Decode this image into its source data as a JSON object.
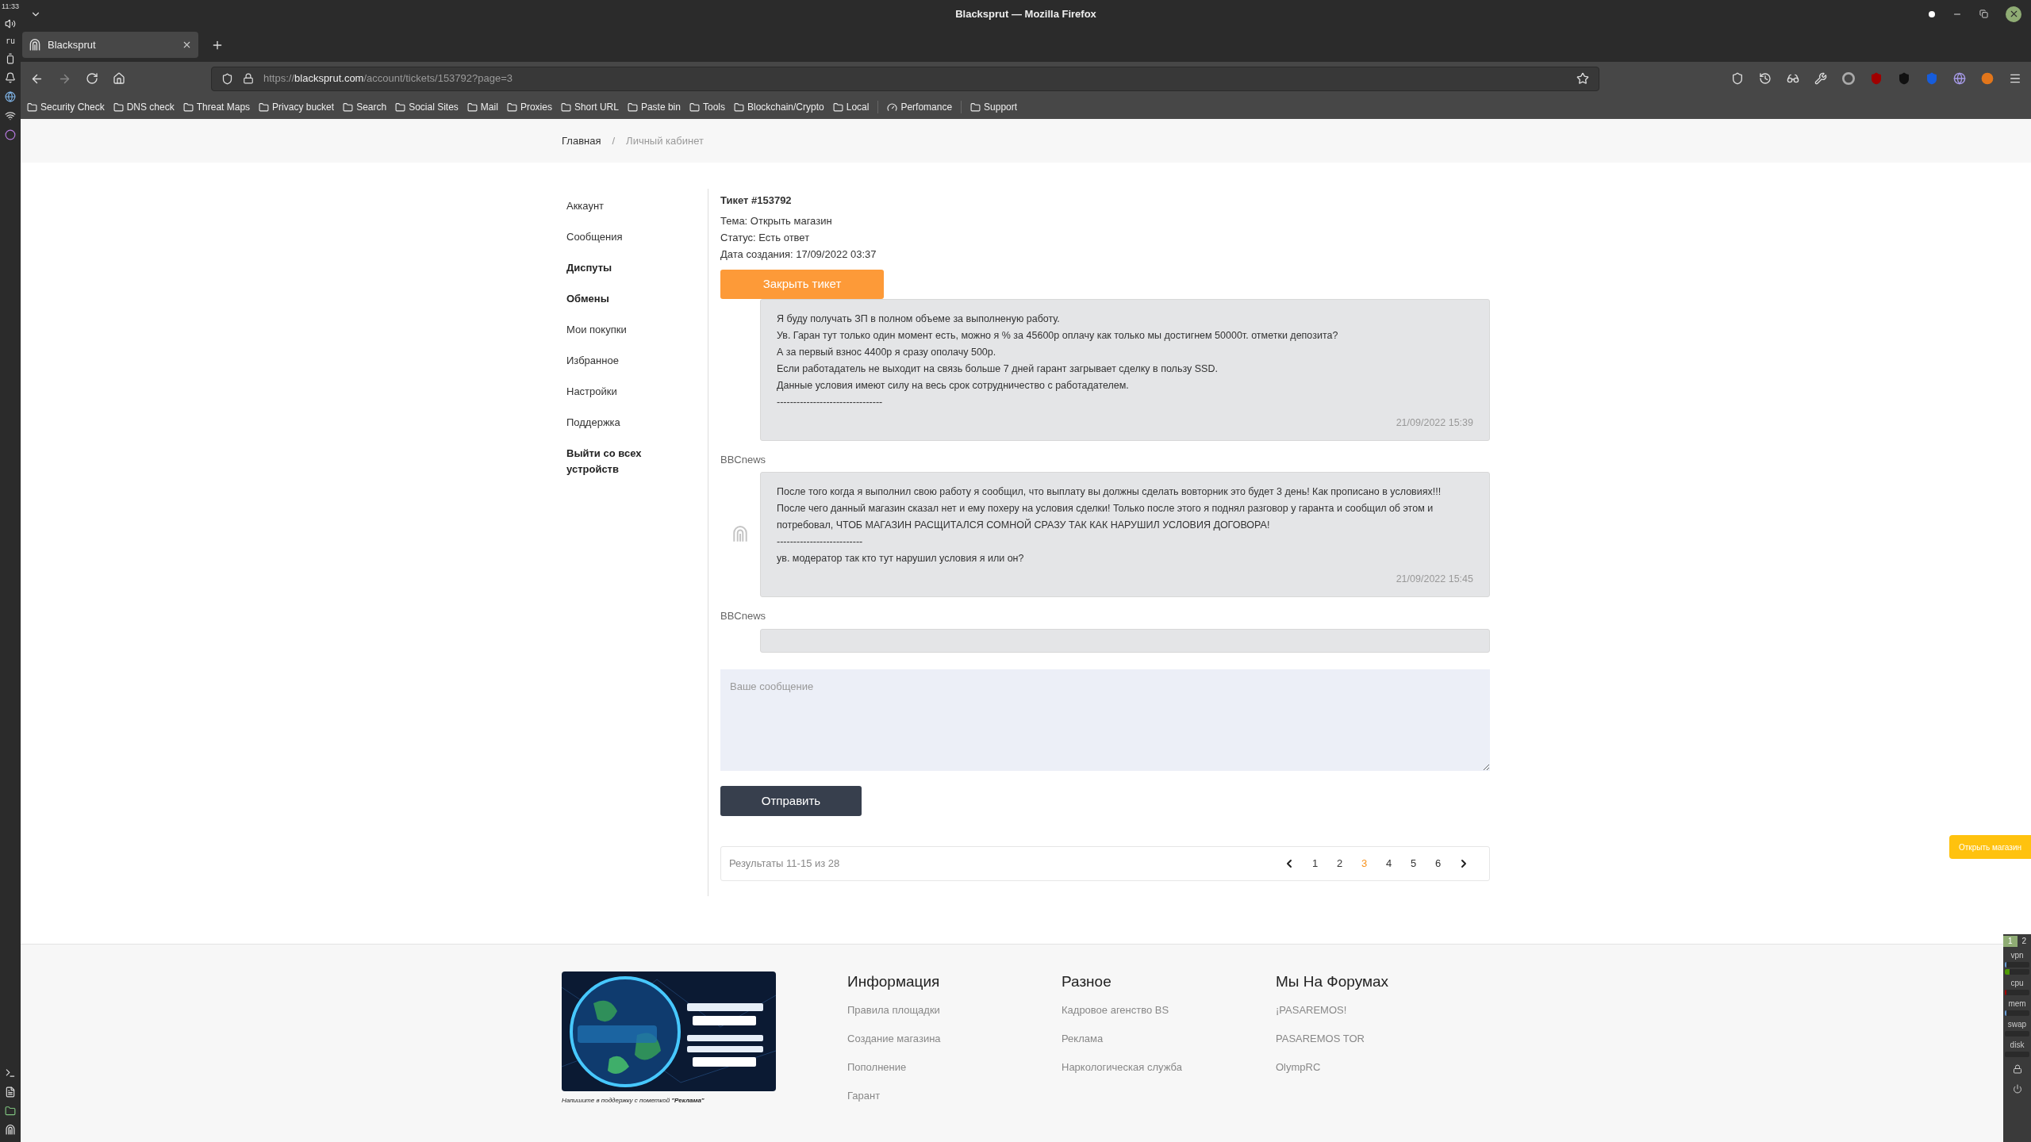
{
  "desktop_panel": {
    "clock": "11:33",
    "keyboard_layout": "ru"
  },
  "window": {
    "title": "Blacksprut — Mozilla Firefox"
  },
  "tabs": [
    {
      "label": "Blacksprut",
      "selected": true
    }
  ],
  "address_bar": {
    "scheme": "https://",
    "domain": "blacksprut.com",
    "path": "/account/tickets/153792?page=3"
  },
  "bookmarks": [
    {
      "label": "Security Check",
      "kind": "folder"
    },
    {
      "label": "DNS check",
      "kind": "folder"
    },
    {
      "label": "Threat Maps",
      "kind": "folder"
    },
    {
      "label": "Privacy bucket",
      "kind": "folder"
    },
    {
      "label": "Search",
      "kind": "folder"
    },
    {
      "label": "Social Sites",
      "kind": "folder"
    },
    {
      "label": "Mail",
      "kind": "folder"
    },
    {
      "label": "Proxies",
      "kind": "folder"
    },
    {
      "label": "Short URL",
      "kind": "folder"
    },
    {
      "label": "Paste bin",
      "kind": "folder"
    },
    {
      "label": "Tools",
      "kind": "folder"
    },
    {
      "label": "Blockchain/Crypto",
      "kind": "folder"
    },
    {
      "label": "Local",
      "kind": "folder"
    },
    {
      "label": "Perfomance",
      "kind": "link"
    },
    {
      "label": "Support",
      "kind": "folder"
    }
  ],
  "breadcrumb": {
    "separator": "/",
    "items": [
      {
        "label": "Главная",
        "current": false
      },
      {
        "label": "Личный кабинет",
        "current": true
      }
    ]
  },
  "sidebar": {
    "items": [
      {
        "label": "Аккаунт",
        "emphasized": false
      },
      {
        "label": "Сообщения",
        "emphasized": false
      },
      {
        "label": "Диспуты",
        "emphasized": true
      },
      {
        "label": "Обмены",
        "emphasized": true
      },
      {
        "label": "Мои покупки",
        "emphasized": false
      },
      {
        "label": "Избранное",
        "emphasized": false
      },
      {
        "label": "Настройки",
        "emphasized": false
      },
      {
        "label": "Поддержка",
        "emphasized": false
      },
      {
        "label": "Выйти со всех устройств",
        "emphasized": true
      }
    ]
  },
  "ticket": {
    "title": "Тикет #153792",
    "details": [
      "Тема: Открыть магазин",
      "Статус: Есть ответ",
      "Дата создания: 17/09/2022 03:37"
    ],
    "close_button": "Закрыть тикет"
  },
  "messages": [
    {
      "avatar": false,
      "lines": [
        "Я буду получать ЗП в полном объеме за выполненую работу.",
        "Ув. Гаран тут только один момент есть, можно я % за 45600р оплачу как только мы достигнем 50000т. отметки депозита?",
        "А за первый взнос 4400р я сразу ополачу 500р.",
        "Если работадатель не выходит на связь больше 7 дней гарант загрывает сделку в пользу SSD.",
        "Данные условия имеют силу на весь срок сотрудничество с работадателем.",
        "--------------------------------"
      ],
      "time": "21/09/2022 15:39"
    },
    {
      "author": "BBCnews",
      "avatar": true,
      "lines": [
        "После того когда я выполнил свою работу я сообщил, что выплату вы должны сделать вовторник это будет 3 день! Как прописано в условиях!!!",
        "После чего данный магазин сказал нет и ему похеру на условия сделки! Только после этого я поднял разговор у гаранта и сообщил об этом и потребовал, ЧТОБ МАГАЗИН РАСЩИТАЛСЯ СОМНОЙ СРАЗУ ТАК КАК НАРУШИЛ УСЛОВИЯ ДОГОВОРА!",
        "--------------------------",
        "ув. модератор так кто тут нарушил условия я или он?"
      ],
      "time": "21/09/2022 15:45"
    },
    {
      "author": "BBCnews",
      "avatar": false
    }
  ],
  "reply": {
    "placeholder": "Ваше сообщение",
    "send_button": "Отправить"
  },
  "pagination": {
    "summary": "Результаты 11-15 из 28",
    "pages": [
      {
        "label": "1",
        "selected": false
      },
      {
        "label": "2",
        "selected": false
      },
      {
        "label": "3",
        "selected": true
      },
      {
        "label": "4",
        "selected": false
      },
      {
        "label": "5",
        "selected": false
      },
      {
        "label": "6",
        "selected": false
      }
    ]
  },
  "floating_button": "Открыть магазин",
  "footer": {
    "banner": {
      "kind": "picture",
      "caption": "Напишите в поддержку с пометкой **\"Реклама\"**"
    },
    "columns": [
      {
        "title": "Информация",
        "links": [
          "Правила площадки",
          "Создание магазина",
          "Пополнение",
          "Гарант"
        ]
      },
      {
        "title": "Разное",
        "links": [
          "Кадровое агенство BS",
          "Реклама",
          "Наркологическая служба"
        ]
      },
      {
        "title": "Мы На Форумах",
        "links": [
          "¡PASAREMOS!",
          "PASAREMOS TOR",
          "OlympRC"
        ]
      }
    ]
  },
  "system_tray": {
    "workspaces": [
      {
        "label": "1",
        "selected": true
      },
      {
        "label": "2",
        "selected": false
      }
    ],
    "meters": [
      {
        "label": "vpn",
        "bars": [
          {
            "level": 0.03,
            "color": "#6a9fd8"
          },
          {
            "level": 0.2,
            "color": "#4e9a06"
          }
        ]
      },
      {
        "label": "cpu",
        "bars": [
          {
            "level": 0.08,
            "color": "#a40000"
          }
        ]
      },
      {
        "label": "mem",
        "bars": [
          {
            "level": 0.06,
            "color": "#6a9fd8"
          }
        ]
      },
      {
        "label": "swap"
      },
      {
        "label": "disk"
      }
    ]
  }
}
